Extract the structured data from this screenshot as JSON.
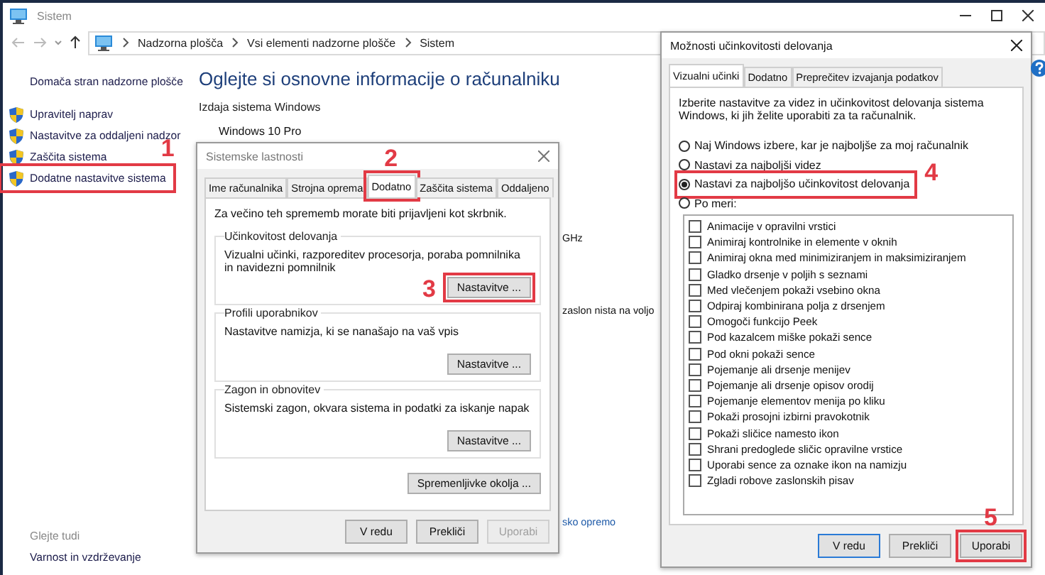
{
  "window": {
    "title": "Sistem"
  },
  "breadcrumb": [
    "Nadzorna plošča",
    "Vsi elementi nadzorne plošče",
    "Sistem"
  ],
  "sidebar": {
    "items": [
      {
        "label": "Domača stran nadzorne plošče",
        "kind": "link"
      },
      {
        "label": "Upravitelj naprav",
        "kind": "shield"
      },
      {
        "label": "Nastavitve za oddaljeni nadzor",
        "kind": "shield"
      },
      {
        "label": "Zaščita sistema",
        "kind": "shield"
      },
      {
        "label": "Dodatne nastavitve sistema",
        "kind": "shield",
        "callout": "1"
      }
    ],
    "see_also_title": "Glejte tudi",
    "see_also": [
      "Varnost in vzdrževanje"
    ]
  },
  "main": {
    "heading": "Oglejte si osnovne informacije o računalniku",
    "section": "Izdaja sistema Windows",
    "edition": "Windows 10 Pro",
    "fragments": [
      {
        "text": "GHz",
        "kind": "text"
      },
      {
        "text": "zaslon nista na voljo",
        "kind": "text"
      },
      {
        "text": "sko opremo",
        "kind": "link"
      }
    ]
  },
  "system_properties": {
    "title": "Sistemske lastnosti",
    "tabs": [
      {
        "label": "Ime računalnika",
        "selected": false
      },
      {
        "label": "Strojna oprema",
        "selected": false
      },
      {
        "label": "Dodatno",
        "selected": true,
        "callout": "2"
      },
      {
        "label": "Zaščita sistema",
        "selected": false
      },
      {
        "label": "Oddaljeno",
        "selected": false
      }
    ],
    "note": "Za večino teh sprememb morate biti prijavljeni kot skrbnik.",
    "groups": [
      {
        "title": "Učinkovitost delovanja",
        "description": "Vizualni učinki, razporeditev procesorja, poraba pomnilnika in navidezni pomnilnik",
        "button": "Nastavitve ...",
        "callout": "3"
      },
      {
        "title": "Profili uporabnikov",
        "description": "Nastavitve namizja, ki se nanašajo na vaš vpis",
        "button": "Nastavitve ..."
      },
      {
        "title": "Zagon in obnovitev",
        "description": "Sistemski zagon, okvara sistema in podatki za iskanje napak",
        "button": "Nastavitve ..."
      }
    ],
    "env_button": "Spremenljivke okolja ...",
    "buttons": [
      {
        "label": "V redu",
        "disabled": false
      },
      {
        "label": "Prekliči",
        "disabled": false
      },
      {
        "label": "Uporabi",
        "disabled": true
      }
    ]
  },
  "performance_options": {
    "title": "Možnosti učinkovitosti delovanja",
    "tabs": [
      {
        "label": "Vizualni učinki",
        "selected": true
      },
      {
        "label": "Dodatno",
        "selected": false
      },
      {
        "label": "Preprečitev izvajanja podatkov",
        "selected": false
      }
    ],
    "description": "Izberite nastavitve za videz in učinkovitost delovanja sistema Windows, ki jih želite uporabiti za ta računalnik.",
    "options": [
      {
        "label": "Naj Windows izbere, kar je najboljše za moj računalnik",
        "selected": false
      },
      {
        "label": "Nastavi za najboljši videz",
        "selected": false
      },
      {
        "label": "Nastavi za najboljšo učinkovitost delovanja",
        "selected": true,
        "callout": "4"
      },
      {
        "label": "Po meri:",
        "selected": false
      }
    ],
    "checkboxes": [
      {
        "label": "Animacije v opravilni vrstici",
        "checked": false
      },
      {
        "label": "Animiraj kontrolnike in elemente v oknih",
        "checked": false
      },
      {
        "label": "Animiraj okna med minimiziranjem in maksimiziranjem",
        "checked": false
      },
      {
        "label": "Gladko drsenje v poljih s seznami",
        "checked": false
      },
      {
        "label": "Med vlečenjem pokaži vsebino okna",
        "checked": false
      },
      {
        "label": "Odpiraj kombinirana polja z drsenjem",
        "checked": false
      },
      {
        "label": "Omogoči funkcijo Peek",
        "checked": false
      },
      {
        "label": "Pod kazalcem miške pokaži sence",
        "checked": false
      },
      {
        "label": "Pod okni pokaži sence",
        "checked": false
      },
      {
        "label": "Pojemanje ali drsenje menijev",
        "checked": false
      },
      {
        "label": "Pojemanje ali drsenje opisov orodij",
        "checked": false
      },
      {
        "label": "Pojemanje elementov menija po kliku",
        "checked": false
      },
      {
        "label": "Pokaži prosojni izbirni pravokotnik",
        "checked": false
      },
      {
        "label": "Pokaži sličice namesto ikon",
        "checked": false
      },
      {
        "label": "Shrani predoglede sličic opravilne vrstice",
        "checked": false
      },
      {
        "label": "Uporabi sence za oznake ikon na namizju",
        "checked": false
      },
      {
        "label": "Zgladi robove zaslonskih pisav",
        "checked": false
      }
    ],
    "buttons": [
      {
        "label": "V redu",
        "default": true
      },
      {
        "label": "Prekliči",
        "default": false
      },
      {
        "label": "Uporabi",
        "default": false,
        "callout": "5"
      }
    ]
  }
}
